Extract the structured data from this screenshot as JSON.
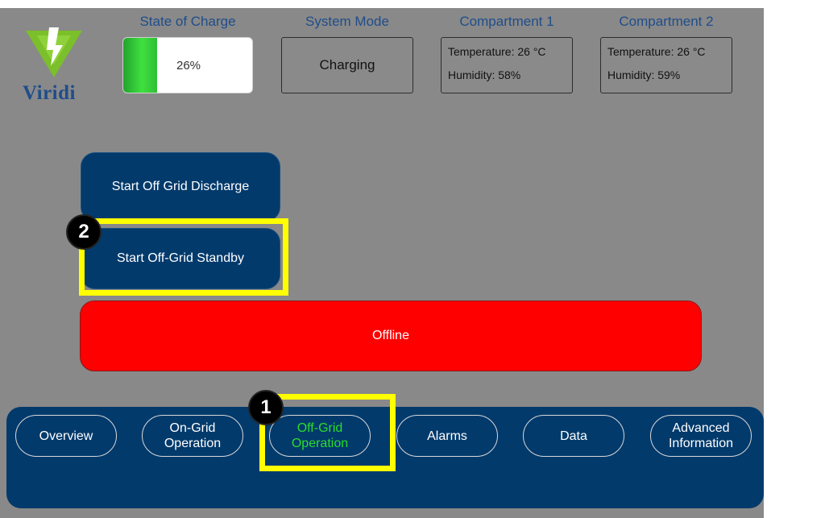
{
  "brand": {
    "name": "Viridi"
  },
  "header": {
    "soc": {
      "label": "State of Charge",
      "value": "26%",
      "fraction": 0.26
    },
    "mode": {
      "label": "System Mode",
      "value": "Charging"
    },
    "compartments": [
      {
        "label": "Compartment 1",
        "temperature": "Temperature: 26 °C",
        "humidity": "Humidity: 58%"
      },
      {
        "label": "Compartment 2",
        "temperature": "Temperature: 26 °C",
        "humidity": "Humidity: 59%"
      }
    ]
  },
  "actions": {
    "discharge_label": "Start Off Grid Discharge",
    "standby_label": "Start Off-Grid Standby",
    "status_label": "Offline"
  },
  "nav": {
    "items": [
      {
        "label": "Overview"
      },
      {
        "label": "On-Grid Operation"
      },
      {
        "label": "Off-Grid Operation",
        "active": true
      },
      {
        "label": "Alarms"
      },
      {
        "label": "Data"
      },
      {
        "label": "Advanced Information"
      }
    ]
  },
  "annotations": {
    "marker1": "1",
    "marker2": "2"
  },
  "colors": {
    "background": "#898989",
    "navy": "#023a6c",
    "offline_red": "#ff0000",
    "active_green": "#2bdc2b",
    "highlight": "#ffff00",
    "charge_green": "#3fe040"
  }
}
